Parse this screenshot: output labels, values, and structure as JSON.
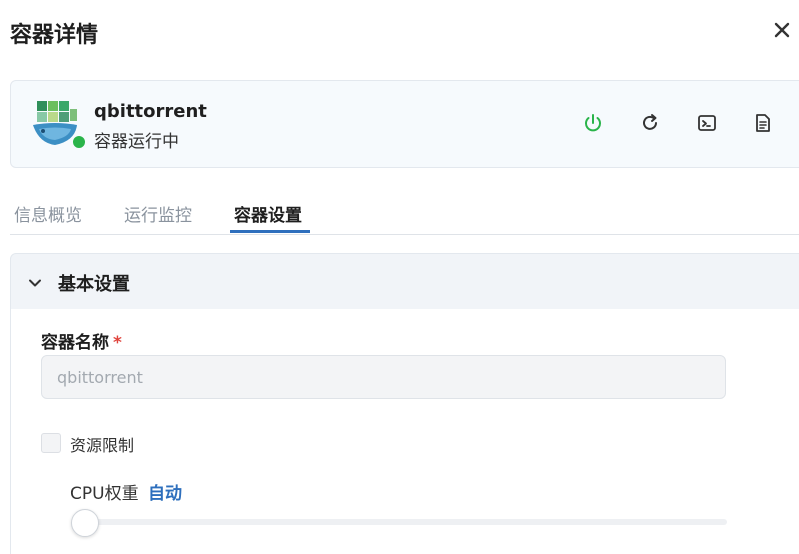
{
  "dialog": {
    "title": "容器详情",
    "close_icon": "close-icon"
  },
  "container": {
    "name": "qbittorrent",
    "status": "容器运行中",
    "status_color": "#2ab44a",
    "actions": [
      {
        "name": "power-icon",
        "color": "#2ab44a"
      },
      {
        "name": "restart-icon",
        "color": "#333333"
      },
      {
        "name": "terminal-icon",
        "color": "#333333"
      },
      {
        "name": "log-icon",
        "color": "#333333"
      }
    ]
  },
  "tabs": [
    {
      "label": "信息概览",
      "active": false
    },
    {
      "label": "运行监控",
      "active": false
    },
    {
      "label": "容器设置",
      "active": true
    }
  ],
  "basic_settings": {
    "title": "基本设置",
    "name_label": "容器名称",
    "required_mark": "*",
    "name_value": "qbittorrent",
    "resource_limit_label": "资源限制",
    "resource_limit_checked": false,
    "cpu_weight_label": "CPU权重",
    "cpu_weight_value": "自动",
    "cpu_weight_slider_fraction": 0
  },
  "colors": {
    "accent": "#2e6fbd",
    "required": "#e0443d"
  }
}
